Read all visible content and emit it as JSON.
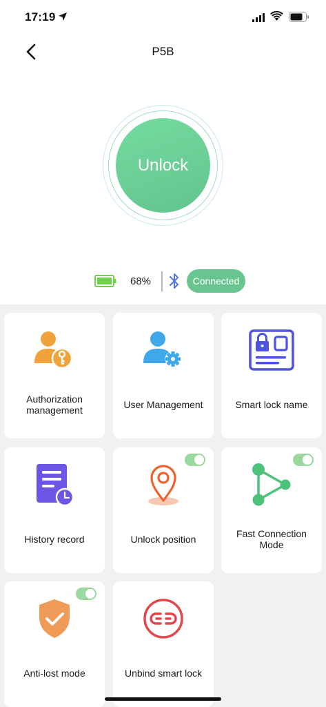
{
  "status_bar": {
    "time": "17:19"
  },
  "nav": {
    "title": "P5B"
  },
  "unlock": {
    "label": "Unlock"
  },
  "device_status": {
    "battery_percent": "68%",
    "connection": "Connected"
  },
  "colors": {
    "accent_green": "#68c590",
    "card_bg": "#ffffff",
    "page_bg": "#f1f1f1"
  },
  "features": [
    {
      "label": "Authorization management",
      "icon": "user-key-icon"
    },
    {
      "label": "User Management",
      "icon": "user-gear-icon"
    },
    {
      "label": "Smart lock name",
      "icon": "id-card-lock-icon"
    },
    {
      "label": "History record",
      "icon": "document-clock-icon"
    },
    {
      "label": "Unlock position",
      "icon": "location-pin-icon",
      "toggle_on": true
    },
    {
      "label": "Fast Connection Mode",
      "icon": "share-nodes-icon",
      "toggle_on": true
    },
    {
      "label": "Anti-lost mode",
      "icon": "shield-check-icon",
      "toggle_on": true
    },
    {
      "label": "Unbind smart lock",
      "icon": "unlink-icon"
    }
  ]
}
